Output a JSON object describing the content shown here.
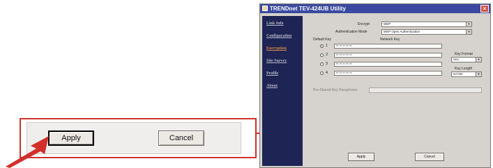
{
  "zoom": {
    "apply_label": "Apply",
    "cancel_label": "Cancel"
  },
  "window": {
    "title": "TRENDnet TEV-424UB Utility",
    "close_glyph": "×",
    "nav": [
      "Link Info",
      "Configuration",
      "Encryption",
      "Site Survey",
      "Profile",
      "About"
    ],
    "active_nav": "Encryption",
    "encrypt_label": "Encrypt",
    "encrypt_value": "WEP",
    "auth_label": "Authentication Mode",
    "auth_value": "WEP Open Authentication",
    "default_key_label": "Default Key",
    "network_key_label": "Network Key",
    "keys": [
      {
        "num": "1",
        "value": "** ** ** ** **",
        "selected": true
      },
      {
        "num": "2",
        "value": "** ** ** ** **",
        "selected": false
      },
      {
        "num": "3",
        "value": "** ** ** ** **",
        "selected": false
      },
      {
        "num": "4",
        "value": "** ** ** ** **",
        "selected": false
      }
    ],
    "key_format_label": "Key Format",
    "key_format_value": "Hex",
    "key_length_label": "Key Length",
    "key_length_value": "64 bits",
    "passphrase_label": "Pre-Shared Key Passphrase",
    "apply_label": "Apply",
    "cancel_label": "Cancel"
  },
  "colors": {
    "callout": "#d1302a",
    "sidebar": "#1e2453",
    "titlebar": "#3b4aa0",
    "active_nav": "#d4884b"
  }
}
